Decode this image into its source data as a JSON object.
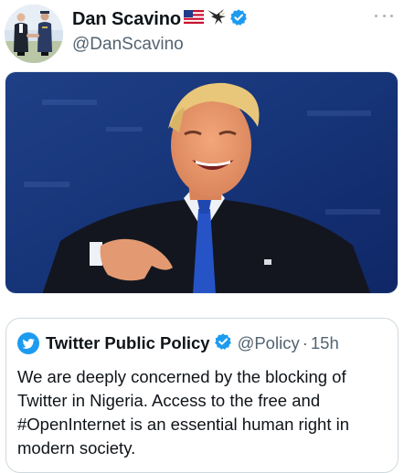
{
  "author": {
    "display_name": "Dan Scavino",
    "handle": "@DanScavino",
    "name_emojis": [
      "us-flag-icon",
      "eagle-icon"
    ],
    "verified": true,
    "avatar": "profile-photo"
  },
  "media": {
    "kind": "photo",
    "description_icon": "man-smiling-pointing-photo"
  },
  "quoted_tweet": {
    "display_name": "Twitter Public Policy",
    "handle": "@Policy",
    "separator": "·",
    "time": "15h",
    "verified": true,
    "text": "We are deeply concerned by the blocking of\nTwitter in Nigeria. Access to the free and\n#OpenInternet is an essential human right in\nmodern society."
  },
  "colors": {
    "verified_blue": "#1d9bf0",
    "secondary_text": "#536471",
    "primary_text": "#0f1419",
    "border": "#cfd9de"
  }
}
